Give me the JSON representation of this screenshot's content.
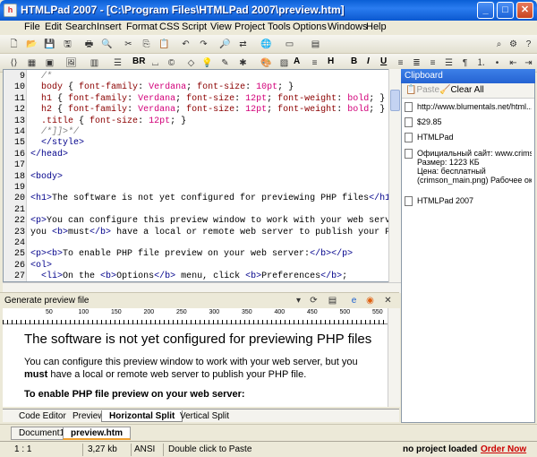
{
  "window": {
    "title": "HTMLPad 2007 - [C:\\Program Files\\HTMLPad 2007\\preview.htm]",
    "app_icon": "h"
  },
  "menus": [
    "File",
    "Edit",
    "Search",
    "Insert",
    "Format",
    "CSS",
    "Script",
    "View",
    "Project",
    "Tools",
    "Options",
    "Windows",
    "Help"
  ],
  "toolbar": {
    "br_label": "BR",
    "align_label": "A",
    "h_label": "H",
    "b_label": "B",
    "i_label": "I",
    "u_label": "U",
    "copy_char": "©",
    "page_char": "¶"
  },
  "editor": {
    "lines": [
      {
        "n": "9",
        "html": "<span class='cm'>  /*<![CDATA[*/</span>"
      },
      {
        "n": "10",
        "html": "  <span class='sel'>body</span> { <span class='prop'>font-family</span>: <span class='val'>Verdana</span>; <span class='prop'>font-size</span>: <span class='val'>10pt</span>; }"
      },
      {
        "n": "11",
        "html": "  <span class='sel'>h1</span> { <span class='prop'>font-family</span>: <span class='val'>Verdana</span>; <span class='prop'>font-size</span>: <span class='val'>12pt</span>; <span class='prop'>font-weight</span>: <span class='val'>bold</span>; }"
      },
      {
        "n": "12",
        "html": "  <span class='sel'>h2</span> { <span class='prop'>font-family</span>: <span class='val'>Verdana</span>; <span class='prop'>font-size</span>: <span class='val'>12pt</span>; <span class='prop'>font-weight</span>: <span class='val'>bold</span>; }"
      },
      {
        "n": "13",
        "html": "  <span class='sel'>.title</span> { <span class='prop'>font-size</span>: <span class='val'>12pt</span>; }"
      },
      {
        "n": "14",
        "html": "<span class='cm'>  /*]]>*/</span>"
      },
      {
        "n": "15",
        "html": "  <span class='tag'>&lt;/style&gt;</span>"
      },
      {
        "n": "16",
        "html": "<span class='tag'>&lt;/head&gt;</span>"
      },
      {
        "n": "17",
        "html": ""
      },
      {
        "n": "18",
        "html": "<span class='tag'>&lt;body&gt;</span>"
      },
      {
        "n": "19",
        "html": ""
      },
      {
        "n": "20",
        "html": "<span class='tag'>&lt;h1&gt;</span>The software is not yet configured for previewing PHP files<span class='tag'>&lt;/h1&gt;</span>"
      },
      {
        "n": "21",
        "html": ""
      },
      {
        "n": "22",
        "html": "<span class='tag'>&lt;p&gt;</span>You can configure this preview window to work with your web server,"
      },
      {
        "n": "23",
        "html": "you <span class='tag'>&lt;b&gt;</span>must<span class='tag'>&lt;/b&gt;</span> have a local or remote web server to publish your PHP"
      },
      {
        "n": "24",
        "html": ""
      },
      {
        "n": "25",
        "html": "<span class='tag'>&lt;p&gt;&lt;b&gt;</span>To enable PHP file preview on your web server:<span class='tag'>&lt;/b&gt;&lt;/p&gt;</span>"
      },
      {
        "n": "26",
        "html": "<span class='tag'>&lt;ol&gt;</span>"
      },
      {
        "n": "27",
        "html": "  <span class='tag'>&lt;li&gt;</span>On the <span class='tag'>&lt;b&gt;</span>Options<span class='tag'>&lt;/b&gt;</span> menu, click <span class='tag'>&lt;b&gt;</span>Preferences<span class='tag'>&lt;/b&gt;</span>;"
      }
    ]
  },
  "preview": {
    "bar_label": "Generate preview file",
    "ruler": [
      "50",
      "100",
      "150",
      "200",
      "250",
      "300",
      "350",
      "400",
      "450",
      "500",
      "550"
    ],
    "h1": "The software is not yet configured for previewing PHP files",
    "p1_a": "You can configure this preview window to work with your web server, but you",
    "p1_b_bold": "must",
    "p1_c": " have a local or remote web server to publish your PHP file.",
    "p2": "To enable PHP file preview on your web server:"
  },
  "view_tabs": [
    "Code Editor",
    "Preview",
    "Horizontal Split",
    "Vertical Split"
  ],
  "active_view_tab": "Horizontal Split",
  "doc_tabs": [
    "Document1",
    "preview.htm"
  ],
  "status": {
    "pos": "1 : 1",
    "size": "3,27 kb",
    "enc": "ANSI",
    "hint": "Double click to Paste",
    "project": "no project loaded",
    "order": "Order Now"
  },
  "clipboard": {
    "title": "Clipboard",
    "paste": "Paste",
    "clear": "Clear All",
    "items": [
      "http://www.blumentals.net/html...",
      "$29.85",
      "HTMLPad",
      "Официальный сайт: www.crims...",
      "Размер: 1223 КБ",
      "Цена: бесплатный",
      "(crimson_main.png) Рабочее ок...",
      "HTMLPad 2007"
    ]
  },
  "colors": {
    "accent": "#0a5fd6",
    "tag": "#00008b",
    "value": "#d2007a",
    "order_link": "#cc0000"
  }
}
